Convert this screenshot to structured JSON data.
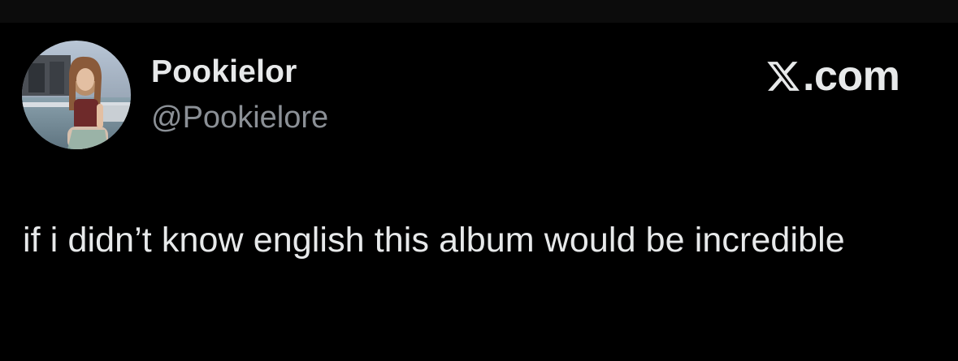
{
  "author": {
    "display_name": "Pookielor",
    "handle": "@Pookielore",
    "avatar_icon": "profile-photo"
  },
  "brand": {
    "icon": "x-logo-icon",
    "text": ".com"
  },
  "tweet": {
    "text": "if i didn’t know english this album would be incredible"
  },
  "colors": {
    "background": "#000000",
    "text": "#e7e9ea",
    "secondary_text": "#8b9096"
  }
}
